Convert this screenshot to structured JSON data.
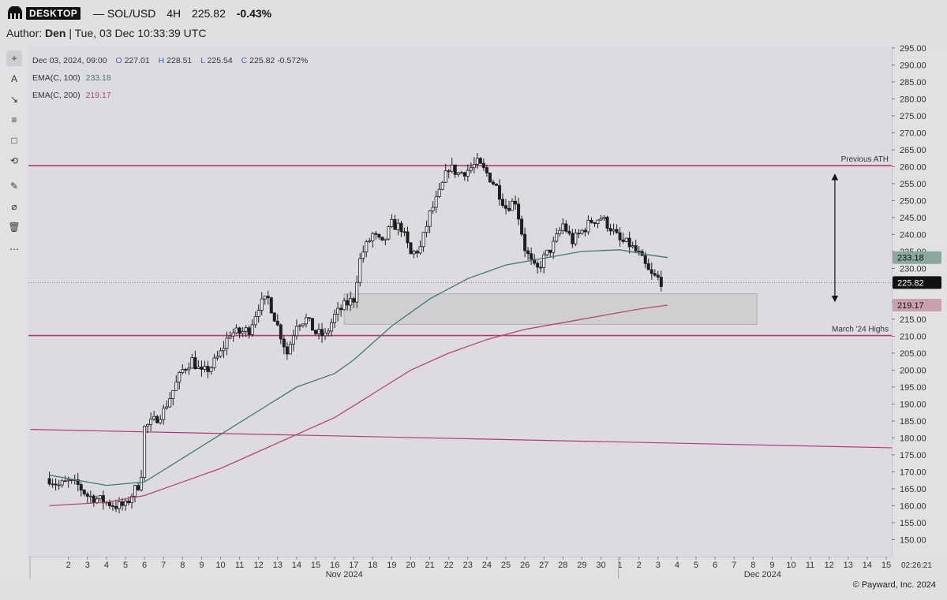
{
  "header": {
    "logo_text": "DESKTOP",
    "symbol": "— SOL/USD",
    "interval": "4H",
    "last_price": "225.82",
    "change_pct": "-0.43%",
    "author_label": "Author:",
    "author_name": "Den",
    "author_meta": "| Tue, 03 Dec 10:33:39 UTC"
  },
  "legend": {
    "date": "Dec 03, 2024, 09:00",
    "o_label": "O",
    "o_value": "227.01",
    "h_label": "H",
    "h_value": "228.51",
    "l_label": "L",
    "l_value": "225.54",
    "c_label": "C",
    "c_value": "225.82",
    "change": "-0.572%",
    "ema100_label": "EMA(C, 100)",
    "ema100_value": "233.18",
    "ema200_label": "EMA(C, 200)",
    "ema200_value": "219.17"
  },
  "toolbar": {
    "icons": [
      "crosshair-icon",
      "text-icon",
      "arrow-icon",
      "fib-icon",
      "rectangle-icon",
      "measure-icon",
      "brush-icon",
      "hide-icon",
      "trash-icon",
      "more-icon"
    ],
    "glyphs": [
      "+",
      "A",
      "↘",
      "≡",
      "□",
      "⟲",
      "✎",
      "⌀",
      "🗑",
      "⋯"
    ]
  },
  "colors": {
    "candle": "#1f1f1f",
    "ema100": "#3c7a6e",
    "ema200": "#b04a6c",
    "level_line": "#b0397a",
    "zone_fill": "#cfcdd0",
    "last_price_bg": "#111111",
    "ema100_tag_bg": "#8aa89f",
    "ema200_tag_bg": "#c9a0ae"
  },
  "footer": {
    "copyright": "© Payward, Inc. 2024",
    "clock": "02:26:21"
  },
  "chart_data": {
    "type": "candlestick",
    "title": "SOL/USD 4H",
    "xlabel": "",
    "ylabel": "",
    "ylim": [
      148,
      298
    ],
    "y_ticks": [
      150,
      155,
      160,
      165,
      170,
      175,
      180,
      185,
      190,
      195,
      200,
      205,
      210,
      215,
      220,
      225,
      230,
      235,
      240,
      245,
      250,
      255,
      260,
      265,
      270,
      275,
      280,
      285,
      290,
      295
    ],
    "x_ticks": [
      {
        "label": "2",
        "day": 2
      },
      {
        "label": "3",
        "day": 3
      },
      {
        "label": "4",
        "day": 4
      },
      {
        "label": "5",
        "day": 5
      },
      {
        "label": "6",
        "day": 6
      },
      {
        "label": "7",
        "day": 7
      },
      {
        "label": "8",
        "day": 8
      },
      {
        "label": "9",
        "day": 9
      },
      {
        "label": "10",
        "day": 10
      },
      {
        "label": "11",
        "day": 11
      },
      {
        "label": "12",
        "day": 12
      },
      {
        "label": "13",
        "day": 13
      },
      {
        "label": "14",
        "day": 14
      },
      {
        "label": "15",
        "day": 15
      },
      {
        "label": "16",
        "day": 16
      },
      {
        "label": "17",
        "day": 17
      },
      {
        "label": "18",
        "day": 18
      },
      {
        "label": "19",
        "day": 19
      },
      {
        "label": "20",
        "day": 20
      },
      {
        "label": "21",
        "day": 21
      },
      {
        "label": "22",
        "day": 22
      },
      {
        "label": "23",
        "day": 23
      },
      {
        "label": "24",
        "day": 24
      },
      {
        "label": "25",
        "day": 25
      },
      {
        "label": "26",
        "day": 26
      },
      {
        "label": "27",
        "day": 27
      },
      {
        "label": "28",
        "day": 28
      },
      {
        "label": "29",
        "day": 29
      },
      {
        "label": "30",
        "day": 30
      },
      {
        "label": "1",
        "day": 31
      },
      {
        "label": "2",
        "day": 32
      },
      {
        "label": "3",
        "day": 33
      },
      {
        "label": "4",
        "day": 34
      },
      {
        "label": "5",
        "day": 35
      },
      {
        "label": "6",
        "day": 36
      },
      {
        "label": "7",
        "day": 37
      },
      {
        "label": "8",
        "day": 38
      },
      {
        "label": "9",
        "day": 39
      },
      {
        "label": "10",
        "day": 40
      },
      {
        "label": "11",
        "day": 41
      },
      {
        "label": "12",
        "day": 42
      },
      {
        "label": "13",
        "day": 43
      },
      {
        "label": "14",
        "day": 44
      },
      {
        "label": "15",
        "day": 45
      }
    ],
    "month_labels": [
      {
        "label": "Nov 2024",
        "day": 16.5
      },
      {
        "label": "Dec 2024",
        "day": 38.5
      }
    ],
    "close_path": [
      [
        1.0,
        168
      ],
      [
        1.5,
        166
      ],
      [
        2.0,
        167
      ],
      [
        2.5,
        166
      ],
      [
        3.0,
        163
      ],
      [
        3.5,
        162
      ],
      [
        4.0,
        161
      ],
      [
        4.5,
        160
      ],
      [
        5.0,
        160
      ],
      [
        5.4,
        164
      ],
      [
        5.8,
        167
      ],
      [
        6.0,
        183
      ],
      [
        6.5,
        185
      ],
      [
        7.0,
        188
      ],
      [
        7.5,
        194
      ],
      [
        8.0,
        200
      ],
      [
        8.5,
        203
      ],
      [
        9.0,
        199
      ],
      [
        9.5,
        201
      ],
      [
        10.0,
        205
      ],
      [
        10.5,
        211
      ],
      [
        11.0,
        211
      ],
      [
        11.5,
        212
      ],
      [
        12.0,
        219
      ],
      [
        12.5,
        221
      ],
      [
        13.0,
        213
      ],
      [
        13.5,
        205
      ],
      [
        14.0,
        214
      ],
      [
        14.5,
        215
      ],
      [
        15.0,
        211
      ],
      [
        15.5,
        210
      ],
      [
        16.0,
        216
      ],
      [
        16.5,
        219
      ],
      [
        17.0,
        221
      ],
      [
        17.3,
        232
      ],
      [
        17.5,
        235
      ],
      [
        18.0,
        240
      ],
      [
        18.5,
        237
      ],
      [
        19.0,
        243
      ],
      [
        19.5,
        242
      ],
      [
        20.0,
        234
      ],
      [
        20.5,
        236
      ],
      [
        21.0,
        246
      ],
      [
        21.5,
        252
      ],
      [
        22.0,
        260
      ],
      [
        22.5,
        258
      ],
      [
        23.0,
        259
      ],
      [
        23.5,
        261
      ],
      [
        24.0,
        258
      ],
      [
        24.5,
        254
      ],
      [
        25.0,
        248
      ],
      [
        25.5,
        250
      ],
      [
        26.0,
        236
      ],
      [
        26.3,
        232
      ],
      [
        26.6,
        229
      ],
      [
        27.0,
        233
      ],
      [
        27.5,
        237
      ],
      [
        28.0,
        243
      ],
      [
        28.5,
        238
      ],
      [
        29.0,
        241
      ],
      [
        29.5,
        244
      ],
      [
        30.0,
        245
      ],
      [
        30.5,
        242
      ],
      [
        31.0,
        238
      ],
      [
        31.5,
        237
      ],
      [
        32.0,
        234
      ],
      [
        32.3,
        231
      ],
      [
        32.6,
        228
      ],
      [
        33.0,
        227
      ],
      [
        33.2,
        226
      ]
    ],
    "series": [
      {
        "name": "EMA(C, 100)",
        "last": 233.18,
        "x": [
          1,
          4,
          6,
          8,
          10,
          12,
          14,
          16,
          17,
          19,
          21,
          23,
          25,
          27,
          29,
          31,
          32.5,
          33.5
        ],
        "values": [
          169,
          166,
          167,
          174,
          181,
          188,
          195,
          199,
          203,
          213,
          221,
          227,
          231,
          233,
          235,
          235.5,
          234,
          233.18
        ]
      },
      {
        "name": "EMA(C, 200)",
        "last": 219.17,
        "x": [
          1,
          4,
          6,
          8,
          10,
          12,
          14,
          16,
          18,
          20,
          22,
          24,
          26,
          28,
          30,
          32,
          33.5
        ],
        "values": [
          160,
          161,
          163,
          167,
          171,
          176,
          181,
          186,
          193,
          200,
          205,
          209,
          212,
          214,
          216,
          218,
          219.17
        ]
      }
    ],
    "annotations": [
      {
        "type": "hline",
        "y": 260.3,
        "label": "Previous ATH"
      },
      {
        "type": "hline",
        "y": 210.2,
        "label": "March '24 Highs"
      },
      {
        "type": "trendline",
        "from": [
          0,
          182.5
        ],
        "to": [
          46,
          177
        ]
      },
      {
        "type": "zone",
        "x0": 16.5,
        "x1": 38.2,
        "y0": 213.5,
        "y1": 222.5
      },
      {
        "type": "double_arrow",
        "x": 42.3,
        "y0": 257,
        "y1": 221
      }
    ],
    "price_tags": [
      {
        "y": 233.18,
        "label": "233.18",
        "kind": "ema100"
      },
      {
        "y": 225.82,
        "label": "225.82",
        "kind": "last"
      },
      {
        "y": 219.17,
        "label": "219.17",
        "kind": "ema200"
      }
    ],
    "last_price_line": 225.82
  }
}
